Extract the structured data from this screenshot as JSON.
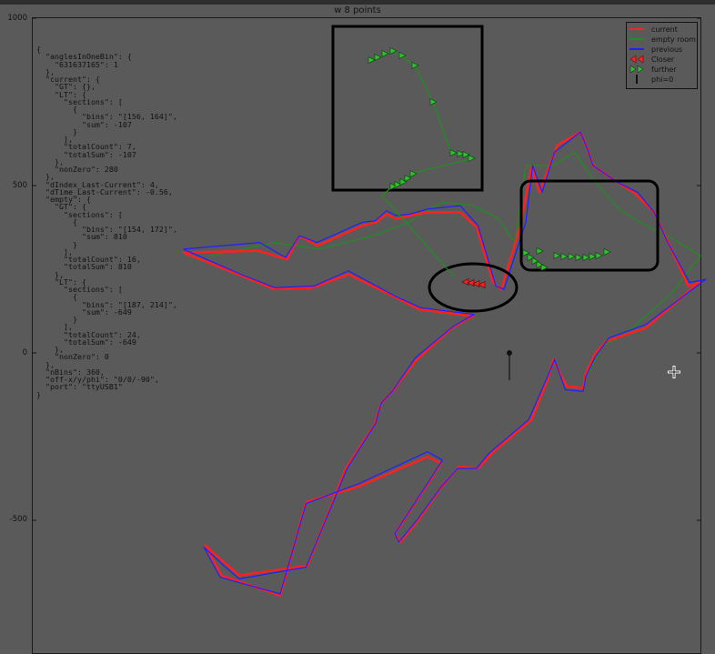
{
  "window": {
    "title": "w 8 points"
  },
  "chart_data": {
    "type": "line",
    "title": "w 8 points",
    "xlabel": "",
    "ylabel": "",
    "ylim": [
      -900,
      1000
    ],
    "yticks": [
      1000,
      500,
      0,
      -500
    ],
    "grid": false,
    "legend_position": "top-right",
    "legend": [
      {
        "name": "current",
        "color": "#ff2020",
        "kind": "line"
      },
      {
        "name": "empty room",
        "color": "#1f8f1f",
        "kind": "line"
      },
      {
        "name": "previous",
        "color": "#2020ff",
        "kind": "line"
      },
      {
        "name": "Closer",
        "color": "#ff2020",
        "kind": "triangle-left"
      },
      {
        "name": "further",
        "color": "#1f8f1f",
        "kind": "triangle-right"
      },
      {
        "name": "phi=0",
        "color": "#111111",
        "kind": "line"
      }
    ],
    "series": [
      {
        "name": "current",
        "color": "#ff2020",
        "points": [
          [
            -1195,
            300
          ],
          [
            -920,
            305
          ],
          [
            -815,
            280
          ],
          [
            -770,
            350
          ],
          [
            -705,
            320
          ],
          [
            -540,
            380
          ],
          [
            -490,
            390
          ],
          [
            -450,
            415
          ],
          [
            -415,
            400
          ],
          [
            -365,
            410
          ],
          [
            -300,
            420
          ],
          [
            -180,
            420
          ],
          [
            -120,
            375
          ],
          [
            -60,
            210
          ],
          [
            -30,
            190
          ],
          [
            40,
            380
          ],
          [
            80,
            555
          ],
          [
            110,
            480
          ],
          [
            175,
            620
          ],
          [
            260,
            660
          ],
          [
            290,
            600
          ],
          [
            305,
            560
          ],
          [
            395,
            510
          ],
          [
            455,
            480
          ],
          [
            530,
            420
          ],
          [
            570,
            350
          ],
          [
            655,
            200
          ],
          [
            695,
            210
          ],
          [
            500,
            75
          ],
          [
            355,
            35
          ],
          [
            315,
            0
          ],
          [
            280,
            -60
          ],
          [
            270,
            -105
          ],
          [
            210,
            -100
          ],
          [
            160,
            -20
          ],
          [
            140,
            -80
          ],
          [
            80,
            -200
          ],
          [
            0,
            -255
          ],
          [
            -65,
            -300
          ],
          [
            -115,
            -345
          ],
          [
            -185,
            -340
          ],
          [
            -245,
            -395
          ],
          [
            -330,
            -495
          ],
          [
            -400,
            -565
          ],
          [
            -420,
            -540
          ],
          [
            -250,
            -330
          ],
          [
            -300,
            -310
          ],
          [
            -555,
            -400
          ],
          [
            -745,
            -445
          ],
          [
            -840,
            -725
          ],
          [
            -1055,
            -665
          ],
          [
            -1115,
            -575
          ],
          [
            -1040,
            -630
          ],
          [
            -990,
            -665
          ],
          [
            -740,
            -635
          ],
          [
            -600,
            -345
          ],
          [
            -495,
            -215
          ],
          [
            -470,
            -150
          ],
          [
            -435,
            -120
          ],
          [
            -340,
            -20
          ],
          [
            -210,
            75
          ],
          [
            -135,
            110
          ],
          [
            -330,
            130
          ],
          [
            -415,
            165
          ],
          [
            -590,
            235
          ],
          [
            -720,
            195
          ],
          [
            -860,
            190
          ],
          [
            -980,
            230
          ],
          [
            -1195,
            300
          ]
        ],
        "width": 2.5
      },
      {
        "name": "previous",
        "color": "#2020ff",
        "points": [
          [
            -1195,
            310
          ],
          [
            -915,
            330
          ],
          [
            -820,
            285
          ],
          [
            -770,
            350
          ],
          [
            -705,
            330
          ],
          [
            -540,
            390
          ],
          [
            -490,
            395
          ],
          [
            -450,
            425
          ],
          [
            -415,
            410
          ],
          [
            -365,
            415
          ],
          [
            -300,
            430
          ],
          [
            -180,
            440
          ],
          [
            -115,
            380
          ],
          [
            -50,
            200
          ],
          [
            -20,
            190
          ],
          [
            60,
            390
          ],
          [
            85,
            560
          ],
          [
            120,
            480
          ],
          [
            165,
            600
          ],
          [
            260,
            660
          ],
          [
            290,
            600
          ],
          [
            305,
            560
          ],
          [
            395,
            510
          ],
          [
            470,
            480
          ],
          [
            530,
            420
          ],
          [
            580,
            330
          ],
          [
            660,
            210
          ],
          [
            720,
            220
          ],
          [
            500,
            85
          ],
          [
            365,
            45
          ],
          [
            315,
            -10
          ],
          [
            280,
            -70
          ],
          [
            270,
            -115
          ],
          [
            205,
            -110
          ],
          [
            165,
            -20
          ],
          [
            135,
            -80
          ],
          [
            70,
            -200
          ],
          [
            -10,
            -255
          ],
          [
            -75,
            -300
          ],
          [
            -120,
            -345
          ],
          [
            -190,
            -345
          ],
          [
            -250,
            -400
          ],
          [
            -335,
            -495
          ],
          [
            -405,
            -565
          ],
          [
            -420,
            -540
          ],
          [
            -245,
            -320
          ],
          [
            -300,
            -295
          ],
          [
            -550,
            -390
          ],
          [
            -745,
            -450
          ],
          [
            -840,
            -720
          ],
          [
            -1060,
            -670
          ],
          [
            -1120,
            -580
          ],
          [
            -1040,
            -640
          ],
          [
            -990,
            -675
          ],
          [
            -745,
            -640
          ],
          [
            -595,
            -345
          ],
          [
            -490,
            -210
          ],
          [
            -470,
            -150
          ],
          [
            -430,
            -115
          ],
          [
            -345,
            -15
          ],
          [
            -205,
            80
          ],
          [
            -130,
            115
          ],
          [
            -325,
            135
          ],
          [
            -420,
            170
          ],
          [
            -590,
            245
          ],
          [
            -715,
            200
          ],
          [
            -860,
            195
          ],
          [
            -985,
            235
          ],
          [
            -1195,
            310
          ]
        ],
        "width": 1.2
      },
      {
        "name": "empty room",
        "color": "#1f8f1f",
        "points": [
          [
            -1100,
            290
          ],
          [
            -860,
            330
          ],
          [
            -700,
            310
          ],
          [
            -500,
            350
          ],
          [
            -370,
            390
          ],
          [
            -250,
            450
          ],
          [
            -130,
            440
          ],
          [
            -40,
            400
          ],
          [
            20,
            330
          ],
          [
            60,
            560
          ],
          [
            160,
            560
          ],
          [
            240,
            600
          ],
          [
            305,
            520
          ],
          [
            400,
            430
          ],
          [
            480,
            390
          ],
          [
            600,
            340
          ],
          [
            700,
            290
          ],
          [
            590,
            175
          ],
          [
            430,
            60
          ],
          [
            340,
            20
          ],
          [
            290,
            -60
          ]
        ],
        "width": 1.2
      }
    ],
    "annotations": {
      "closer_markers_at": [
        -35,
        205
      ],
      "phi0_origin": [
        0,
        0
      ]
    }
  },
  "overlay_text": {
    "lines": [
      "{",
      "  \"anglesInOneBin\": {",
      "    \"631637165\": 1",
      "  },",
      "  \"current\": {",
      "    \"GT\": {},",
      "    \"LT\": {",
      "      \"sections\": [",
      "        {",
      "          \"bins\": \"[156, 164]\",",
      "          \"sum\": -107",
      "        }",
      "      ],",
      "      \"totalCount\": 7,",
      "      \"totalSum\": -107",
      "    },",
      "    \"nonZero\": 280",
      "  },",
      "  \"dIndex_Last-Current\": 4,",
      "  \"dTime_Last-Current\": -0.56,",
      "  \"empty\": {",
      "    \"GT\": {",
      "      \"sections\": [",
      "        {",
      "          \"bins\": \"[154, 172]\",",
      "          \"sum\": 810",
      "        }",
      "      ],",
      "      \"totalCount\": 16,",
      "      \"totalSum\": 810",
      "    },",
      "    \"LT\": {",
      "      \"sections\": [",
      "        {",
      "          \"bins\": \"[187, 214]\",",
      "          \"sum\": -649",
      "        }",
      "      ],",
      "      \"totalCount\": 24,",
      "      \"totalSum\": -649",
      "    },",
      "    \"nonZero\": 0",
      "  },",
      "  \"nBins\": 360,",
      "  \"off-x/y/phi\": \"0/0/-90\",",
      "  \"port\": \"ttyUSB1\"",
      "}"
    ]
  }
}
